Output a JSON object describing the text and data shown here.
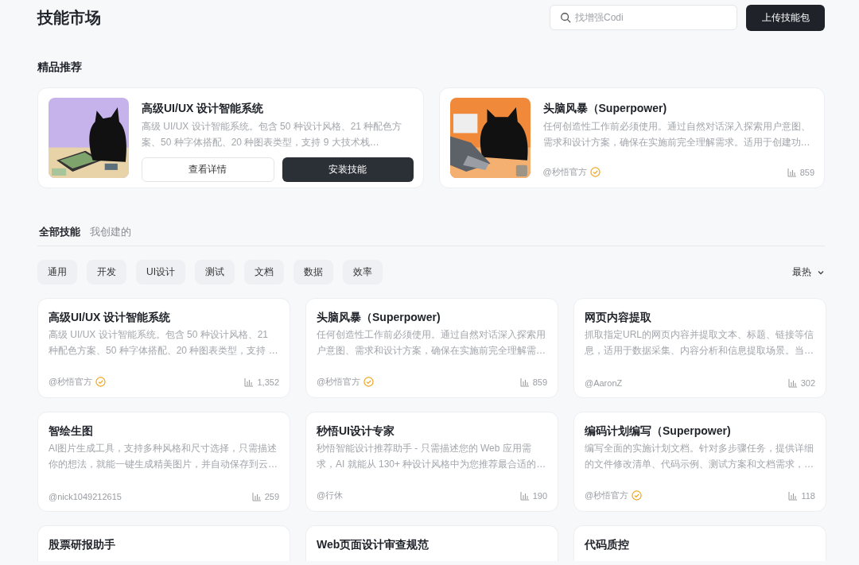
{
  "header": {
    "title": "技能市场",
    "search": {
      "placeholder": "找增强Codi"
    },
    "upload_button": "上传技能包"
  },
  "featured": {
    "title": "精品推荐",
    "items": [
      {
        "kind": "install",
        "title": "高级UI/UX 设计智能系统",
        "description": "高级 UI/UX 设计智能系统。包含 50 种设计风格、21 种配色方案、50 种字体搭配、20 种图表类型，支持 9 大技术栈…",
        "buttons": [
          "查看详情",
          "安装技能"
        ]
      },
      {
        "kind": "stats",
        "title": "头脑风暴（Superpower)",
        "description": "任何创造性工作前必须使用。通过自然对话深入探索用户意图、需求和设计方案，确保在实施前完全理解需求。适用于创建功…",
        "author": "@秒悟官方",
        "verified": true,
        "count": "859"
      }
    ]
  },
  "tabs": [
    {
      "label": "全部技能",
      "selected": true
    },
    {
      "label": "我创建的",
      "selected": false
    }
  ],
  "categories": [
    {
      "label": "通用",
      "selected": false
    },
    {
      "label": "开发",
      "selected": false
    },
    {
      "label": "UI设计",
      "selected": false
    },
    {
      "label": "测试",
      "selected": false
    },
    {
      "label": "文档",
      "selected": false
    },
    {
      "label": "数据",
      "selected": false
    },
    {
      "label": "效率",
      "selected": false
    }
  ],
  "sort": {
    "label": "最热"
  },
  "skills": [
    {
      "title": "高级UI/UX 设计智能系统",
      "description": "高级 UI/UX 设计智能系统。包含 50 种设计风格、21 种配色方案、50 种字体搭配、20 种图表类型，支持 …",
      "author": "@秒悟官方",
      "verified": true,
      "count": "1,352"
    },
    {
      "title": "头脑风暴（Superpower)",
      "description": "任何创造性工作前必须使用。通过自然对话深入探索用户意图、需求和设计方案，确保在实施前完全理解需…",
      "author": "@秒悟官方",
      "verified": true,
      "count": "859"
    },
    {
      "title": "网页内容提取",
      "description": "抓取指定URL的网页内容并提取文本、标题、链接等信息，适用于数据采集、内容分析和信息提取场景。当…",
      "author": "@AaronZ",
      "verified": false,
      "count": "302"
    },
    {
      "title": "智绘生图",
      "description": "AI图片生成工具，支持多种风格和尺寸选择，只需描述你的想法，就能一键生成精美图片，并自动保存到云…",
      "author": "@nick1049212615",
      "verified": false,
      "count": "259"
    },
    {
      "title": "秒悟UI设计专家",
      "description": "秒悟智能设计推荐助手 - 只需描述您的 Web 应用需求，AI 就能从 130+ 种设计风格中为您推荐最合适的…",
      "author": "@行休",
      "verified": false,
      "count": "190"
    },
    {
      "title": "编码计划编写（Superpower)",
      "description": "编写全面的实施计划文档。针对多步骤任务，提供详细的文件修改清单、代码示例、测试方案和文档需求，…",
      "author": "@秒悟官方",
      "verified": true,
      "count": "118"
    },
    {
      "title": "股票研报助手"
    },
    {
      "title": "Web页面设计审查规范"
    },
    {
      "title": "代码质控"
    }
  ]
}
